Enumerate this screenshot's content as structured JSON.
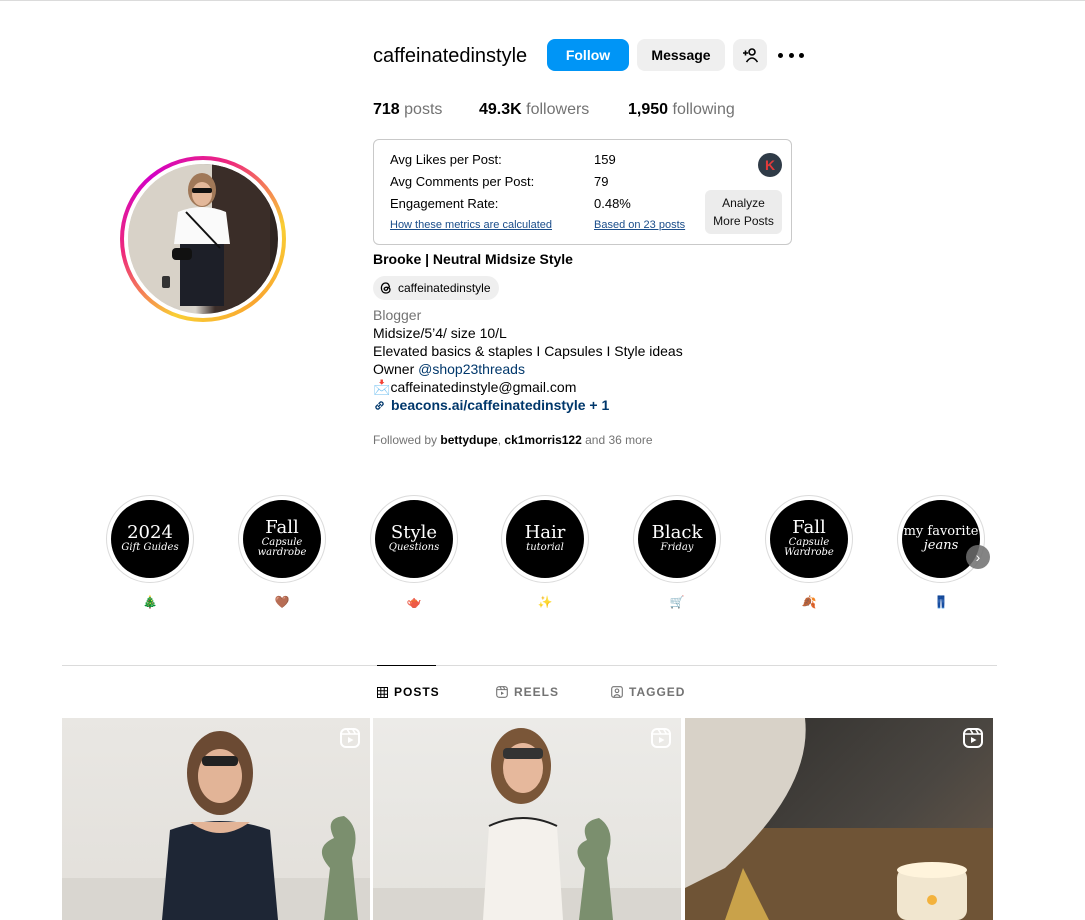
{
  "profile": {
    "username": "caffeinatedinstyle",
    "follow_label": "Follow",
    "message_label": "Message",
    "stats": {
      "posts_count": "718",
      "posts_label": "posts",
      "followers_count": "49.3K",
      "followers_label": "followers",
      "following_count": "1,950",
      "following_label": "following"
    }
  },
  "metrics": {
    "avg_likes_label": "Avg Likes per Post:",
    "avg_likes_value": "159",
    "avg_comments_label": "Avg Comments per Post:",
    "avg_comments_value": "79",
    "engagement_label": "Engagement Rate:",
    "engagement_value": "0.48%",
    "how_link": "How these metrics are calculated",
    "based_link": "Based on 23 posts",
    "badge_letter": "K",
    "analyze_line1": "Analyze",
    "analyze_line2": "More Posts"
  },
  "bio": {
    "full_name": "Brooke | Neutral Midsize Style",
    "threads_handle": "caffeinatedinstyle",
    "category": "Blogger",
    "line1": "Midsize/5’4/ size 10/L",
    "line2": "Elevated basics & staples I Capsules I Style ideas",
    "owner_prefix": "Owner ",
    "owner_mention": "@shop23threads",
    "email_emoji": "📩",
    "email": "caffeinatedinstyle@gmail.com",
    "link": "beacons.ai/caffeinatedinstyle + 1",
    "followed_by_prefix": "Followed by ",
    "followed_user1": "bettydupe",
    "followed_sep": ", ",
    "followed_user2": "ck1morris122",
    "followed_suffix": " and 36 more"
  },
  "highlights": [
    {
      "top": "2024",
      "bottom": "Gift Guides",
      "emoji": "🎄"
    },
    {
      "top": "Fall",
      "bottom": "Capsule wardrobe",
      "emoji": "🤎"
    },
    {
      "top": "Style",
      "bottom": "Questions",
      "emoji": "🫖"
    },
    {
      "top": "Hair",
      "bottom": "tutorial",
      "emoji": "✨"
    },
    {
      "top": "Black",
      "bottom": "Friday",
      "emoji": "🛒"
    },
    {
      "top": "Fall",
      "bottom": "Capsule Wardrobe",
      "emoji": "🍂"
    },
    {
      "top": "my favorite",
      "bottom": "jeans",
      "emoji": "👖"
    }
  ],
  "tabs": [
    {
      "label": "POSTS",
      "icon": "grid-icon",
      "active": true
    },
    {
      "label": "REELS",
      "icon": "reels-icon",
      "active": false
    },
    {
      "label": "TAGGED",
      "icon": "tagged-icon",
      "active": false
    }
  ],
  "colors": {
    "follow_button": "#0095f6",
    "link": "#00376b",
    "metrics_link": "#1a4d8a"
  }
}
